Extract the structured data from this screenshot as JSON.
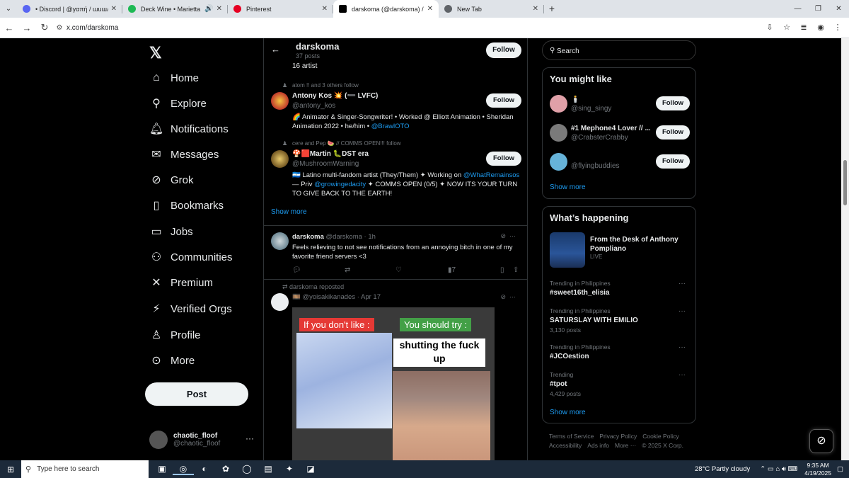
{
  "browser": {
    "tabs": [
      {
        "title": "• Discord | @γαπή / ɯuɯʎ / 6",
        "active": false,
        "color": "#5865f2"
      },
      {
        "title": "Deck Wine • Marietta",
        "active": false,
        "color": "#1db954",
        "audio": true
      },
      {
        "title": "Pinterest",
        "active": false,
        "color": "#e60023"
      },
      {
        "title": "darskoma (@darskoma) / X",
        "active": true,
        "color": "#000000"
      },
      {
        "title": "New Tab",
        "active": false,
        "color": "#5f6368"
      }
    ],
    "url": "x.com/darskoma"
  },
  "sidebar": {
    "items": [
      {
        "label": "Home",
        "icon": "home-icon"
      },
      {
        "label": "Explore",
        "icon": "search-icon"
      },
      {
        "label": "Notifications",
        "icon": "bell-icon"
      },
      {
        "label": "Messages",
        "icon": "envelope-icon"
      },
      {
        "label": "Grok",
        "icon": "grok-icon"
      },
      {
        "label": "Bookmarks",
        "icon": "bookmark-icon"
      },
      {
        "label": "Jobs",
        "icon": "briefcase-icon"
      },
      {
        "label": "Communities",
        "icon": "people-icon"
      },
      {
        "label": "Premium",
        "icon": "x-icon"
      },
      {
        "label": "Verified Orgs",
        "icon": "lightning-icon"
      },
      {
        "label": "Profile",
        "icon": "person-icon"
      },
      {
        "label": "More",
        "icon": "more-circle-icon"
      }
    ],
    "post_label": "Post",
    "user": {
      "name": "chaotic_floof",
      "handle": "@chaotic_floof"
    }
  },
  "profile_header": {
    "name": "darskoma",
    "posts": "37 posts",
    "follow_label": "Follow"
  },
  "main": {
    "artist_tail": "16 artist",
    "accounts": [
      {
        "context": "atom !! and 3 others follow",
        "name": "Antony Kos 💥 (➖ LVFC)",
        "handle": "@antony_kos",
        "bio_pre": "🌈 Animator & Singer-Songwriter! • Worked @ Elliott Animation • Sheridan Animation 2022 • he/him • ",
        "bio_link": "@BrawlOTO",
        "bio_post": "",
        "follow": "Follow"
      },
      {
        "context": "cere and Pep 🍉 // COMMS OPEN!!! follow",
        "name": "🍄🟥Martin 🐛DST era",
        "handle": "@MushroomWarning",
        "bio_pre": "🇳🇮 Latino multi-fandom artist (They/Them) ✦ Working on ",
        "bio_link": "@WhatRemainsos",
        "bio_mid": " — Priv ",
        "bio_link2": "@growingedacity",
        "bio_post": " ✦ COMMS OPEN (0/5) ✦ NOW ITS YOUR TURN TO GIVE BACK TO THE EARTH!",
        "follow": "Follow"
      }
    ],
    "show_more": "Show more",
    "tweet": {
      "name": "darskoma",
      "handle": "@darskoma",
      "time": "· 1h",
      "text": "Feels relieving to not see notifications from an annoying bitch in one of my favorite friend servers <3",
      "views": "7"
    },
    "repost": {
      "context": "darskoma reposted",
      "name": "🎞️",
      "handle": "@yoisakikanades",
      "time": "· Apr 17",
      "meme_left": "If you don't like :",
      "meme_right": "You should try :",
      "meme_caption": "shutting the fuck up"
    }
  },
  "right": {
    "search_placeholder": "Search",
    "might_like_title": "You might like",
    "suggestions": [
      {
        "name": "🕯️",
        "handle": "@sing_singy",
        "follow": "Follow",
        "color": "#e0a0a8"
      },
      {
        "name": "#1 Mephone4 Lover // ...",
        "handle": "@CrabsterCrabby",
        "follow": "Follow",
        "color": "#7a7a7a"
      },
      {
        "name": "",
        "handle": "@flyingbuddies",
        "follow": "Follow",
        "color": "#66b3d9"
      }
    ],
    "show_more": "Show more",
    "happening_title": "What’s happening",
    "news": {
      "title": "From the Desk of Anthony Pompliano",
      "live": "LIVE"
    },
    "trends": [
      {
        "context": "Trending in Philippines",
        "title": "#sweet16th_elisia",
        "count": ""
      },
      {
        "context": "Trending in Philippines",
        "title": "SATURSLAY WITH EMILIO",
        "count": "3,130 posts"
      },
      {
        "context": "Trending in Philippines",
        "title": "#JCOestion",
        "count": ""
      },
      {
        "context": "Trending",
        "title": "#tpot",
        "count": "4,429 posts"
      }
    ],
    "show_more2": "Show more",
    "footer": [
      "Terms of Service",
      "Privacy Policy",
      "Cookie Policy",
      "Accessibility",
      "Ads info",
      "More ···",
      "© 2025 X Corp."
    ]
  },
  "taskbar": {
    "search_placeholder": "Type here to search",
    "weather": "28°C  Partly cloudy",
    "time": "9:35 AM",
    "date": "4/19/2025"
  }
}
